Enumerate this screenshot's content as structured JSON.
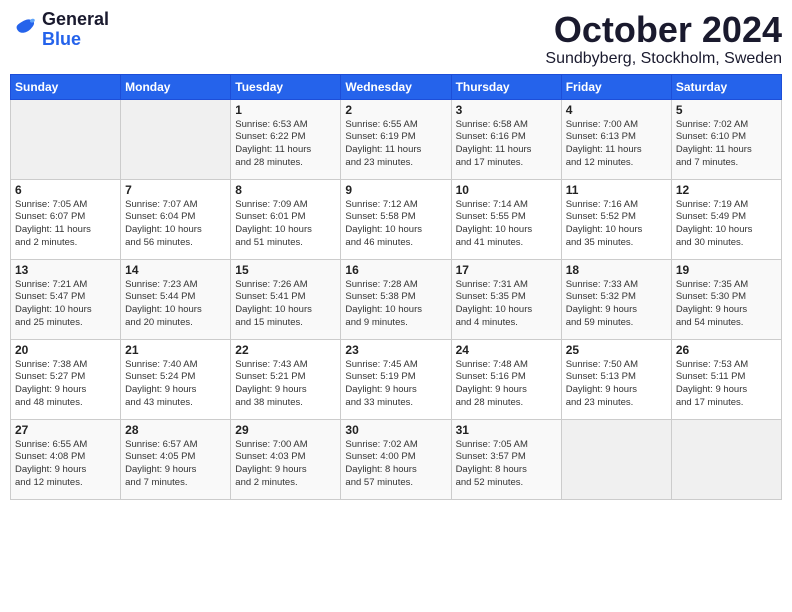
{
  "header": {
    "logo_line1": "General",
    "logo_line2": "Blue",
    "month": "October 2024",
    "location": "Sundbyberg, Stockholm, Sweden"
  },
  "days_of_week": [
    "Sunday",
    "Monday",
    "Tuesday",
    "Wednesday",
    "Thursday",
    "Friday",
    "Saturday"
  ],
  "weeks": [
    [
      {
        "day": "",
        "content": ""
      },
      {
        "day": "",
        "content": ""
      },
      {
        "day": "1",
        "content": "Sunrise: 6:53 AM\nSunset: 6:22 PM\nDaylight: 11 hours\nand 28 minutes."
      },
      {
        "day": "2",
        "content": "Sunrise: 6:55 AM\nSunset: 6:19 PM\nDaylight: 11 hours\nand 23 minutes."
      },
      {
        "day": "3",
        "content": "Sunrise: 6:58 AM\nSunset: 6:16 PM\nDaylight: 11 hours\nand 17 minutes."
      },
      {
        "day": "4",
        "content": "Sunrise: 7:00 AM\nSunset: 6:13 PM\nDaylight: 11 hours\nand 12 minutes."
      },
      {
        "day": "5",
        "content": "Sunrise: 7:02 AM\nSunset: 6:10 PM\nDaylight: 11 hours\nand 7 minutes."
      }
    ],
    [
      {
        "day": "6",
        "content": "Sunrise: 7:05 AM\nSunset: 6:07 PM\nDaylight: 11 hours\nand 2 minutes."
      },
      {
        "day": "7",
        "content": "Sunrise: 7:07 AM\nSunset: 6:04 PM\nDaylight: 10 hours\nand 56 minutes."
      },
      {
        "day": "8",
        "content": "Sunrise: 7:09 AM\nSunset: 6:01 PM\nDaylight: 10 hours\nand 51 minutes."
      },
      {
        "day": "9",
        "content": "Sunrise: 7:12 AM\nSunset: 5:58 PM\nDaylight: 10 hours\nand 46 minutes."
      },
      {
        "day": "10",
        "content": "Sunrise: 7:14 AM\nSunset: 5:55 PM\nDaylight: 10 hours\nand 41 minutes."
      },
      {
        "day": "11",
        "content": "Sunrise: 7:16 AM\nSunset: 5:52 PM\nDaylight: 10 hours\nand 35 minutes."
      },
      {
        "day": "12",
        "content": "Sunrise: 7:19 AM\nSunset: 5:49 PM\nDaylight: 10 hours\nand 30 minutes."
      }
    ],
    [
      {
        "day": "13",
        "content": "Sunrise: 7:21 AM\nSunset: 5:47 PM\nDaylight: 10 hours\nand 25 minutes."
      },
      {
        "day": "14",
        "content": "Sunrise: 7:23 AM\nSunset: 5:44 PM\nDaylight: 10 hours\nand 20 minutes."
      },
      {
        "day": "15",
        "content": "Sunrise: 7:26 AM\nSunset: 5:41 PM\nDaylight: 10 hours\nand 15 minutes."
      },
      {
        "day": "16",
        "content": "Sunrise: 7:28 AM\nSunset: 5:38 PM\nDaylight: 10 hours\nand 9 minutes."
      },
      {
        "day": "17",
        "content": "Sunrise: 7:31 AM\nSunset: 5:35 PM\nDaylight: 10 hours\nand 4 minutes."
      },
      {
        "day": "18",
        "content": "Sunrise: 7:33 AM\nSunset: 5:32 PM\nDaylight: 9 hours\nand 59 minutes."
      },
      {
        "day": "19",
        "content": "Sunrise: 7:35 AM\nSunset: 5:30 PM\nDaylight: 9 hours\nand 54 minutes."
      }
    ],
    [
      {
        "day": "20",
        "content": "Sunrise: 7:38 AM\nSunset: 5:27 PM\nDaylight: 9 hours\nand 48 minutes."
      },
      {
        "day": "21",
        "content": "Sunrise: 7:40 AM\nSunset: 5:24 PM\nDaylight: 9 hours\nand 43 minutes."
      },
      {
        "day": "22",
        "content": "Sunrise: 7:43 AM\nSunset: 5:21 PM\nDaylight: 9 hours\nand 38 minutes."
      },
      {
        "day": "23",
        "content": "Sunrise: 7:45 AM\nSunset: 5:19 PM\nDaylight: 9 hours\nand 33 minutes."
      },
      {
        "day": "24",
        "content": "Sunrise: 7:48 AM\nSunset: 5:16 PM\nDaylight: 9 hours\nand 28 minutes."
      },
      {
        "day": "25",
        "content": "Sunrise: 7:50 AM\nSunset: 5:13 PM\nDaylight: 9 hours\nand 23 minutes."
      },
      {
        "day": "26",
        "content": "Sunrise: 7:53 AM\nSunset: 5:11 PM\nDaylight: 9 hours\nand 17 minutes."
      }
    ],
    [
      {
        "day": "27",
        "content": "Sunrise: 6:55 AM\nSunset: 4:08 PM\nDaylight: 9 hours\nand 12 minutes."
      },
      {
        "day": "28",
        "content": "Sunrise: 6:57 AM\nSunset: 4:05 PM\nDaylight: 9 hours\nand 7 minutes."
      },
      {
        "day": "29",
        "content": "Sunrise: 7:00 AM\nSunset: 4:03 PM\nDaylight: 9 hours\nand 2 minutes."
      },
      {
        "day": "30",
        "content": "Sunrise: 7:02 AM\nSunset: 4:00 PM\nDaylight: 8 hours\nand 57 minutes."
      },
      {
        "day": "31",
        "content": "Sunrise: 7:05 AM\nSunset: 3:57 PM\nDaylight: 8 hours\nand 52 minutes."
      },
      {
        "day": "",
        "content": ""
      },
      {
        "day": "",
        "content": ""
      }
    ]
  ]
}
